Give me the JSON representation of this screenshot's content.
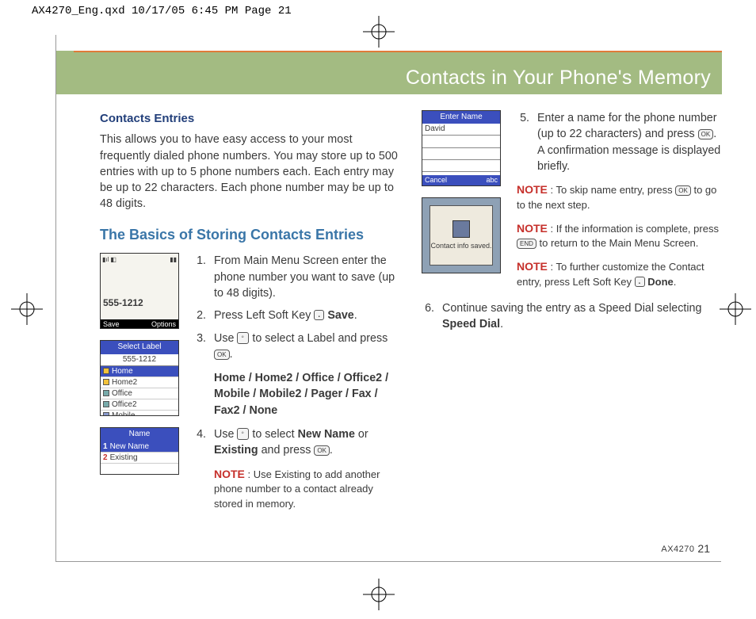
{
  "slug": "AX4270_Eng.qxd  10/17/05  6:45 PM  Page 21",
  "section_title": "Contacts in Your Phone's Memory",
  "entries_heading": "Contacts Entries",
  "entries_para": "This allows you to have easy access to your most frequently dialed phone numbers. You may store up to 500 entries with up to 5 phone numbers each. Each entry may be up to 22 characters. Each phone number may be up to 48 digits.",
  "basics_heading": "The Basics of Storing Contacts Entries",
  "steps": {
    "s1": "From Main Menu Screen enter the phone number you want to save (up to 48 digits).",
    "s2a": "Press Left Soft Key ",
    "s2b": "Save",
    "s3a": "Use ",
    "s3b": " to select a Label and press ",
    "s3labels": "Home / Home2 / Office / Office2 / Mobile / Mobile2 / Pager / Fax / Fax2 / None",
    "s4a": "Use ",
    "s4b": " to select ",
    "s4c": "New Name",
    "s4d": " or ",
    "s4e": "Existing",
    "s4f": " and press ",
    "note4": ": Use Existing to add another phone number to a contact already stored in memory.",
    "s5a": "Enter a name for the phone number (up to 22 characters) and press ",
    "s5b": ". A confirmation message is displayed briefly.",
    "note5a": ": To skip name entry, press ",
    "note5a2": " to go to the next step.",
    "note5b": ": If the information is complete, press ",
    "note5b2": " to return to the Main Menu Screen.",
    "note5c": ": To further customize the Contact entry, press Left Soft Key ",
    "note5c2": "Done",
    "s6a": "Continue saving the entry as a Speed Dial selecting ",
    "s6b": "Speed Dial"
  },
  "note_label": "NOTE",
  "screens": {
    "dial_number": "555-1212",
    "dial_save": "Save",
    "dial_options": "Options",
    "sel_title": "Select Label",
    "sel_num": "555-1212",
    "sel_items": [
      "Home",
      "Home2",
      "Office",
      "Office2",
      "Mobile"
    ],
    "name_title": "Name",
    "name_items": [
      "New Name",
      "Existing"
    ],
    "enter_title": "Enter Name",
    "enter_value": "David",
    "enter_cancel": "Cancel",
    "enter_abc": "abc",
    "saved_msg": "Contact info saved."
  },
  "footer_model": "AX4270",
  "footer_page": "21",
  "ok": "OK",
  "end": "END"
}
